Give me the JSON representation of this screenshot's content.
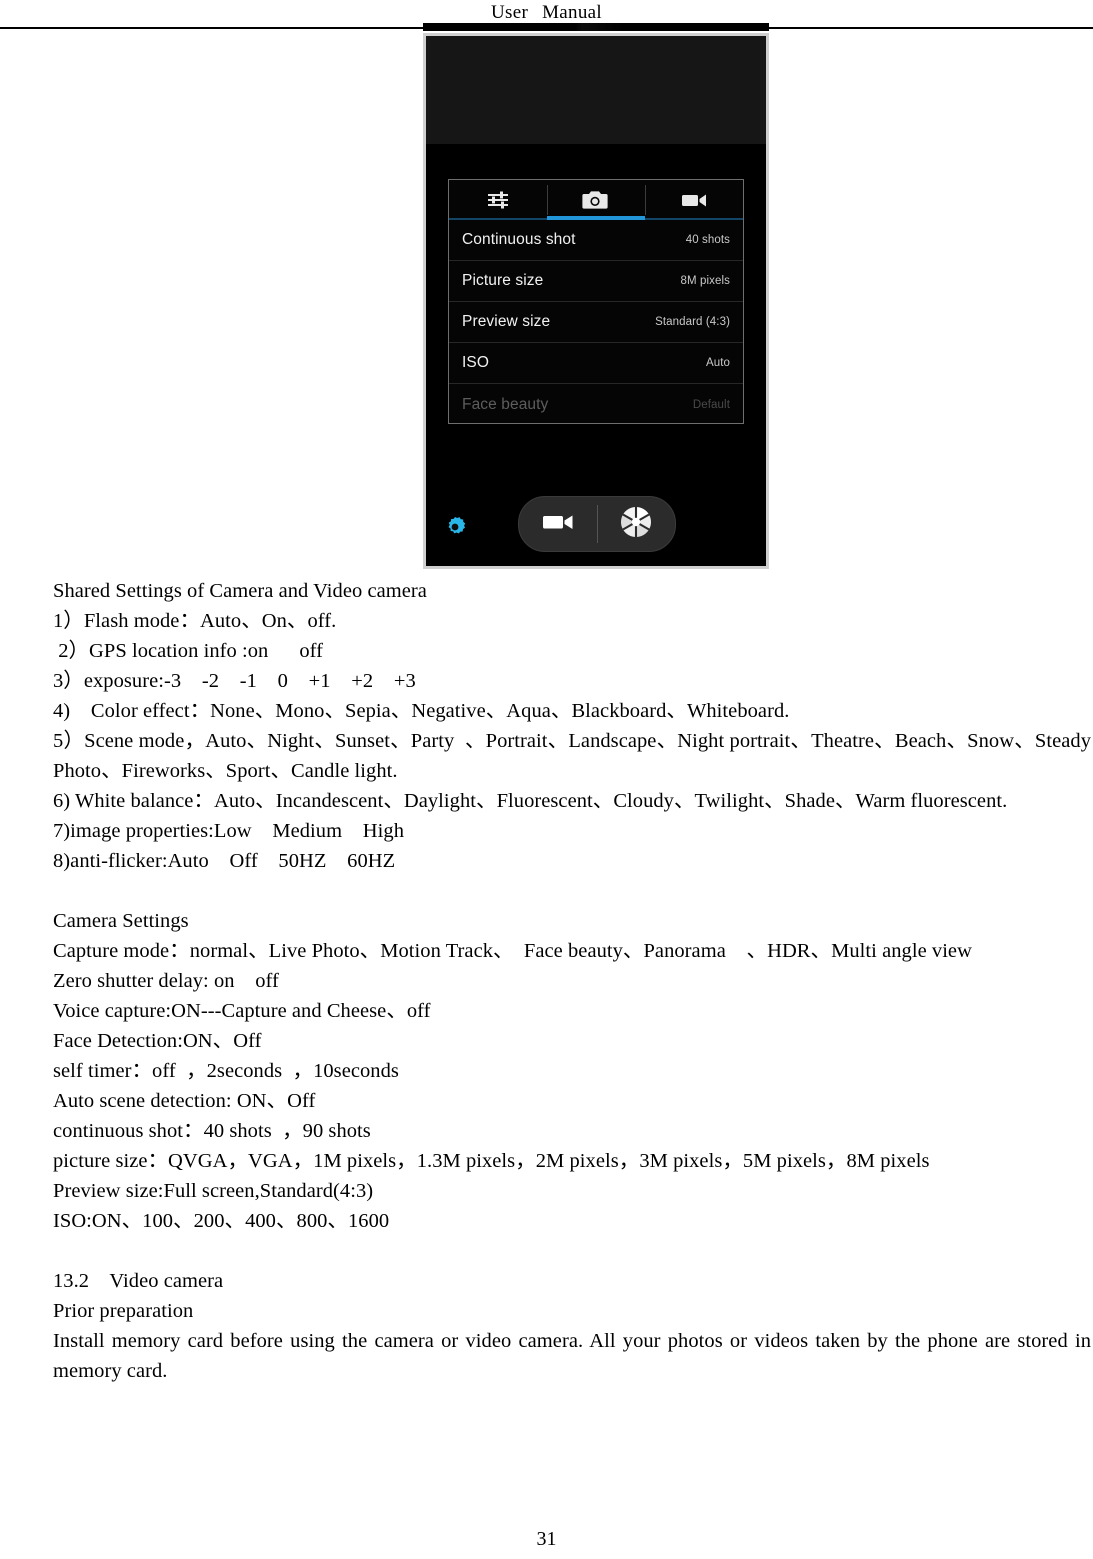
{
  "header": {
    "title_left": "User",
    "title_right": "Manual"
  },
  "figure": {
    "caption_alt": "camera-settings-screenshot",
    "panel": {
      "tabs": [
        {
          "name": "general-settings-tab",
          "icon": "sliders-icon",
          "active": false
        },
        {
          "name": "camera-tab",
          "icon": "camera-icon",
          "active": true
        },
        {
          "name": "video-tab",
          "icon": "video-camera-icon",
          "active": false
        }
      ],
      "rows": [
        {
          "label": "Continuous shot",
          "value": "40 shots",
          "dimmed": false
        },
        {
          "label": "Picture size",
          "value": "8M pixels",
          "dimmed": false
        },
        {
          "label": "Preview size",
          "value": "Standard (4:3)",
          "dimmed": false
        },
        {
          "label": "ISO",
          "value": "Auto",
          "dimmed": false
        },
        {
          "label": "Face beauty",
          "value": "Default",
          "dimmed": true
        }
      ]
    },
    "controls": {
      "gear": "settings-gear-icon",
      "video": "video-record-button",
      "shutter": "shutter-aperture-button"
    },
    "accent_color": "#2196d8",
    "gear_color": "#29b6e8"
  },
  "body": {
    "shared_heading": "Shared Settings of Camera and Video camera",
    "line_flash": "1）Flash mode：Auto、On、off.",
    "line_gps": " 2）GPS location info :on      off",
    "line_exposure": "3）exposure:-3    -2    -1    0    +1    +2    +3",
    "line_color_effect": "4)    Color effect：None、Mono、Sepia、Negative、Aqua、Blackboard、Whiteboard.",
    "line_scene_mode": "5）Scene mode，Auto、Night、Sunset、Party  、Portrait、Landscape、Night portrait、Theatre、Beach、Snow、Steady Photo、Fireworks、Sport、Candle light.",
    "line_white_balance": "6) White balance：Auto、Incandescent、Daylight、Fluorescent、Cloudy、Twilight、Shade、Warm fluorescent.",
    "line_image_properties": "7)image properties:Low    Medium    High",
    "line_anti_flicker": "8)anti-flicker:Auto    Off    50HZ    60HZ",
    "camera_settings_heading": "Camera Settings",
    "line_capture_mode": "Capture mode：normal、Live Photo、Motion Track、  Face beauty、Panorama    、HDR、Multi angle view",
    "line_zero_shutter": "Zero shutter delay: on    off",
    "line_voice_capture": "Voice capture:ON---Capture and Cheese、off",
    "line_face_detection": "Face Detection:ON、Off",
    "line_self_timer": "self timer：off  ，2seconds  ，10seconds",
    "line_auto_scene": "Auto scene detection: ON、Off",
    "line_continuous_shot": "continuous shot：40 shots  ，90 shots",
    "line_picture_size": "picture size：QVGA，VGA，1M pixels，1.3M pixels，2M pixels，3M pixels，5M pixels，8M pixels",
    "line_preview_size": "Preview size:Full screen,Standard(4:3)",
    "line_iso": "ISO:ON、100、200、400、800、1600",
    "video_heading": "13.2    Video camera",
    "prior_preparation": "Prior preparation",
    "install_paragraph": "Install memory card before using the camera or video camera. All your photos or videos taken by the phone are stored in memory card."
  },
  "footer": {
    "page_number": "31"
  }
}
